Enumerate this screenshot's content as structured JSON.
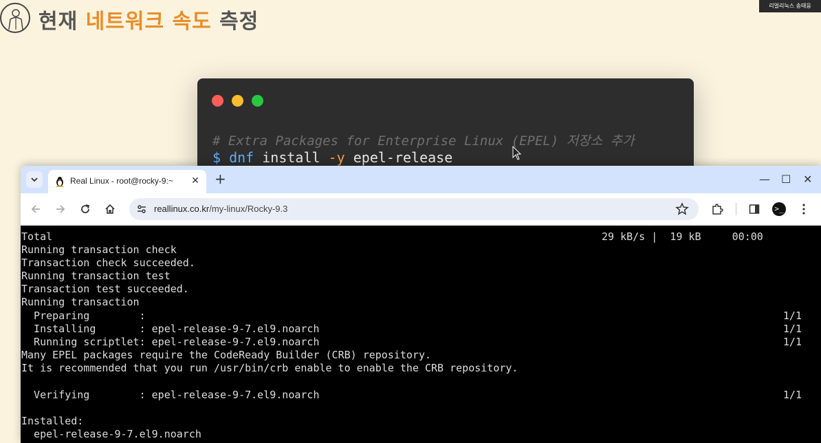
{
  "slide": {
    "title_prefix": "현재 ",
    "title_accent": "네트워크 속도",
    "title_suffix": " 측정",
    "presenter": "리얼리눅스 송태웅"
  },
  "code_card": {
    "comment": "# Extra Packages for Enterprise Linux (EPEL) 저장소 추가",
    "prompt": "$",
    "cmd_dnf": "dnf",
    "cmd_install": "install",
    "cmd_flag": "-y",
    "cmd_pkg": "epel-release"
  },
  "browser": {
    "tab_title": "Real Linux - root@rocky-9:~",
    "tab_close": "✕",
    "new_tab": "+",
    "url_host": "reallinux.co.kr",
    "url_path": "/my-linux/Rocky-9.3",
    "window_controls": {
      "minimize": "—",
      "maximize": "☐",
      "close": "✕"
    },
    "profile_glyph": ">_"
  },
  "terminal": {
    "lines": [
      "Total",
      "Running transaction check",
      "Transaction check succeeded.",
      "Running transaction test",
      "Transaction test succeeded.",
      "Running transaction",
      "  Preparing        :",
      "  Installing       : epel-release-9-7.el9.noarch",
      "  Running scriptlet: epel-release-9-7.el9.noarch",
      "Many EPEL packages require the CodeReady Builder (CRB) repository.",
      "It is recommended that you run /usr/bin/crb enable to enable the CRB repository.",
      "",
      "  Verifying        : epel-release-9-7.el9.noarch",
      "",
      "Installed:",
      "  epel-release-9-7.el9.noarch"
    ],
    "total_stats": "29 kB/s |  19 kB     00:00",
    "progress": [
      "1/1",
      "1/1",
      "1/1",
      "1/1"
    ]
  }
}
